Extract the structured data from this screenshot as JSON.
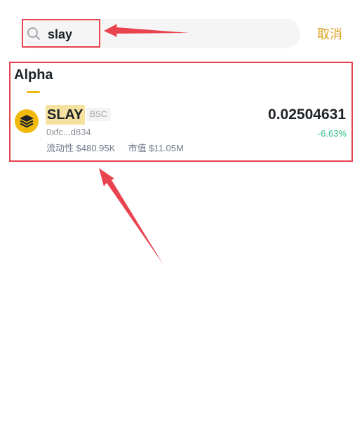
{
  "search": {
    "value": "slay",
    "icon": "search-icon"
  },
  "header": {
    "cancel_label": "取消"
  },
  "section": {
    "title": "Alpha"
  },
  "result": {
    "symbol": "SLAY",
    "chain": "BSC",
    "address": "0xfc...d834",
    "liquidity_label": "流动性",
    "liquidity_value": "$480.95K",
    "mcap_label": "市值",
    "mcap_value": "$11.05M",
    "price": "0.02504631",
    "change": "-6.63%",
    "logo_icon": "stacked-layers-icon"
  },
  "colors": {
    "accent": "#f0b90b",
    "cancel": "#d7a11a",
    "negative_change": "#2ebd85",
    "annotation": "#e8434e"
  }
}
